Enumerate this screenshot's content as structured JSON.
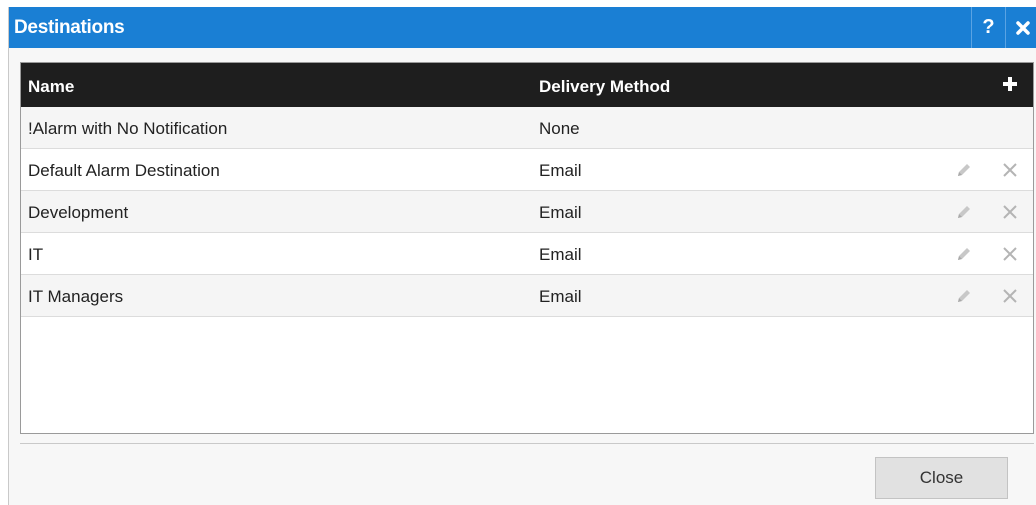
{
  "dialog": {
    "title": "Destinations",
    "help_label": "?",
    "accent_color": "#1a7fd4"
  },
  "grid": {
    "columns": [
      "Name",
      "Delivery Method"
    ],
    "rows": [
      {
        "name": "!Alarm with No Notification",
        "method": "None",
        "editable": false
      },
      {
        "name": "Default Alarm Destination",
        "method": "Email",
        "editable": true
      },
      {
        "name": "Development",
        "method": "Email",
        "editable": true
      },
      {
        "name": "IT",
        "method": "Email",
        "editable": true
      },
      {
        "name": "IT Managers",
        "method": "Email",
        "editable": true
      }
    ],
    "icons": {
      "add": "plus-icon",
      "edit": "pencil-icon",
      "delete": "x-icon"
    }
  },
  "footer": {
    "close_label": "Close"
  }
}
